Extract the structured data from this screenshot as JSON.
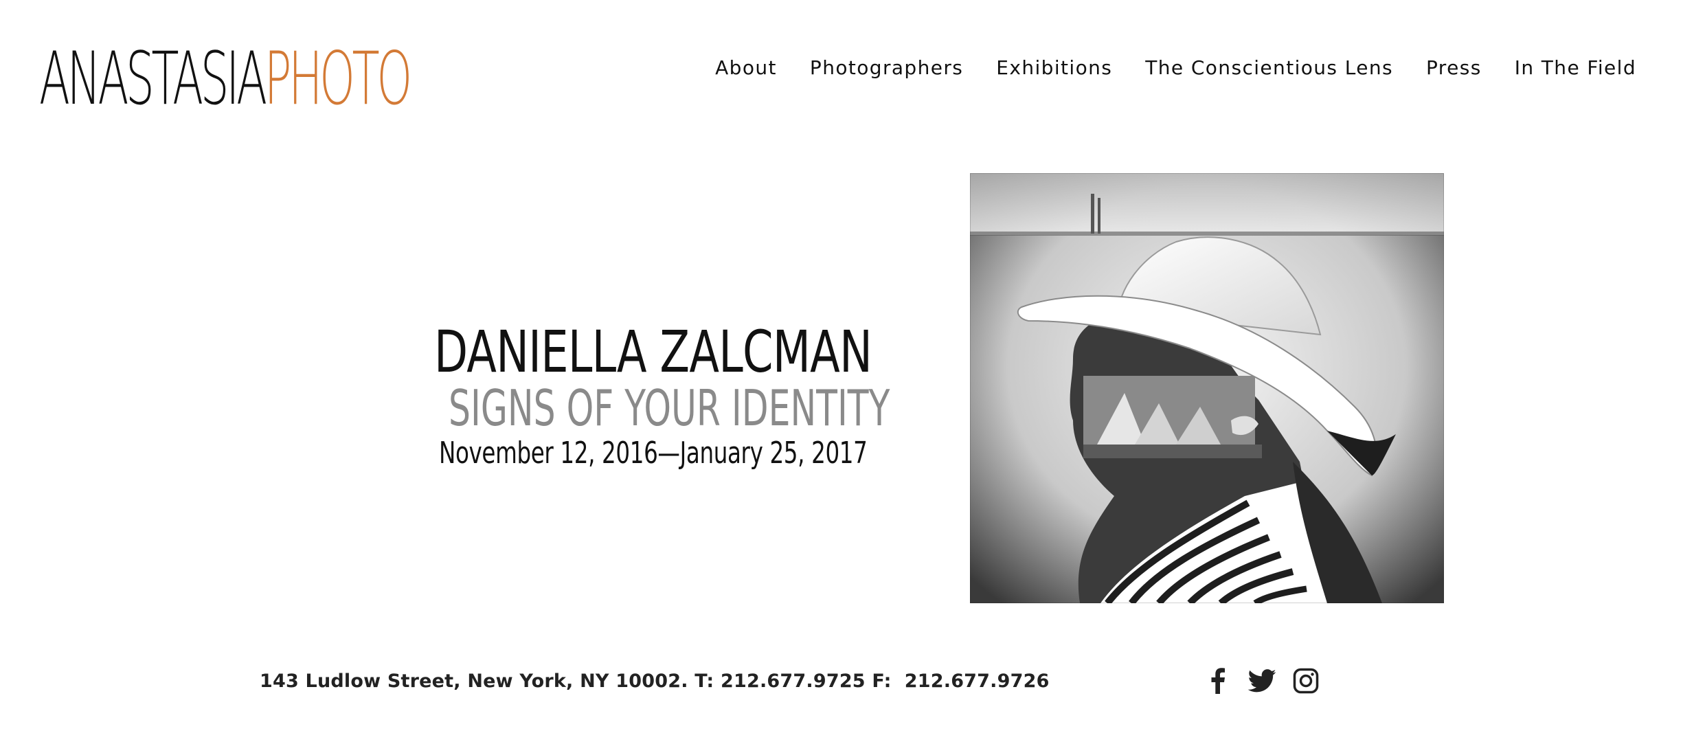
{
  "header": {
    "logo_part1": "ANASTASIA",
    "logo_part2": "PHOTO",
    "logo_accent_color": "#d37a36",
    "nav": [
      {
        "label": "About"
      },
      {
        "label": "Photographers"
      },
      {
        "label": "Exhibitions"
      },
      {
        "label": "The Conscientious Lens"
      },
      {
        "label": "Press"
      },
      {
        "label": "In The Field"
      }
    ]
  },
  "exhibition": {
    "artist": "DANIELLA ZALCMAN",
    "title": "SIGNS OF YOUR IDENTITY",
    "dates": "November 12, 2016—January 25, 2017",
    "title_color": "#8a8a8a"
  },
  "footer": {
    "address": "143 Ludlow Street, New York, NY 10002.",
    "phone_label": "T:",
    "phone": "212.677.9725",
    "fax_label": "F:",
    "fax": "212.677.9726"
  },
  "social": [
    {
      "icon": "facebook-icon"
    },
    {
      "icon": "twitter-icon"
    },
    {
      "icon": "instagram-icon"
    }
  ]
}
